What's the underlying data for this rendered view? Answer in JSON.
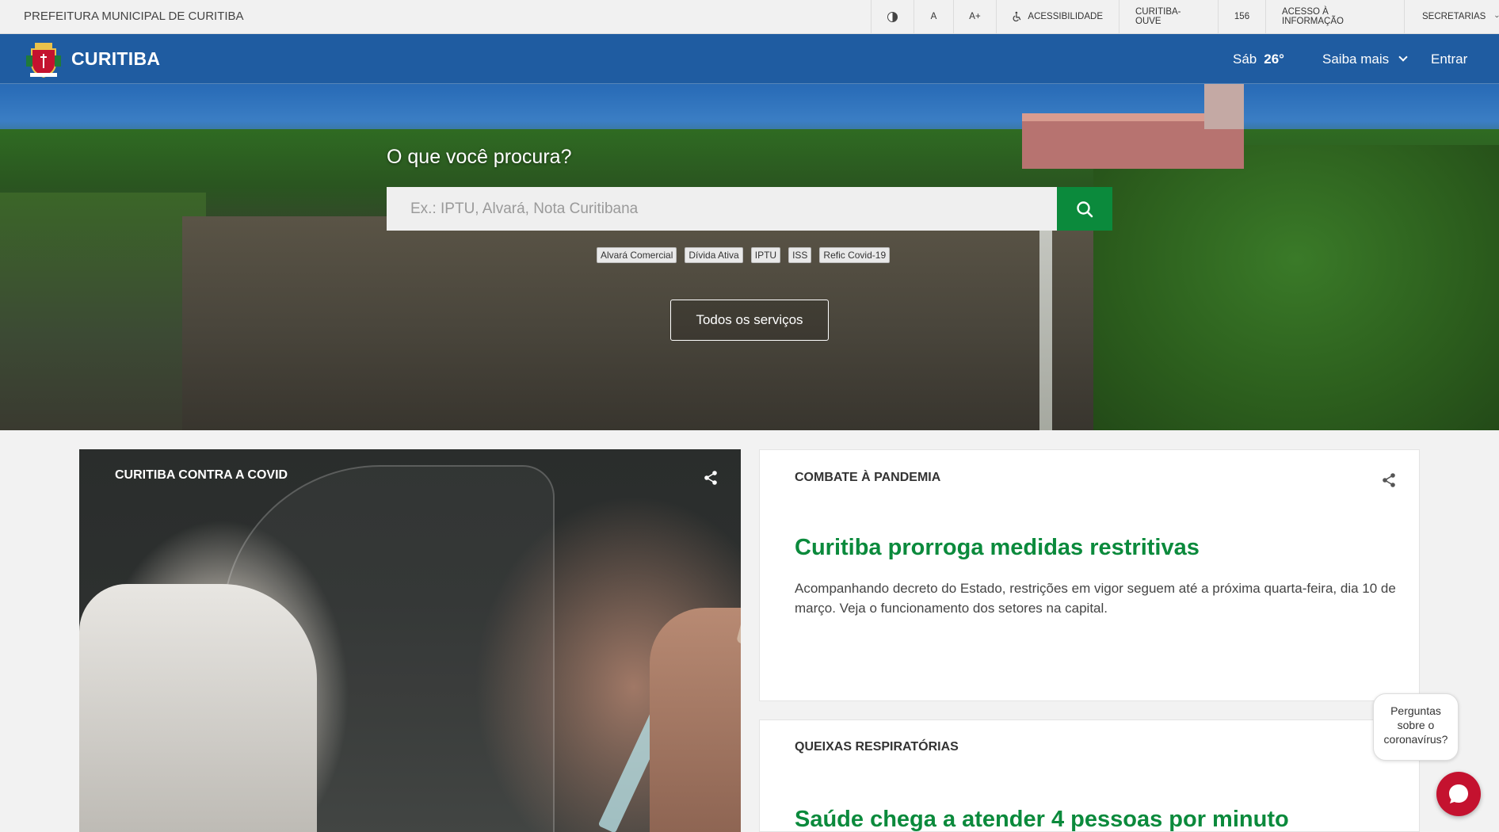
{
  "utility_bar": {
    "org_name": "PREFEITURA MUNICIPAL DE CURITIBA",
    "font_small": "A",
    "font_large": "A+",
    "accessibility": "ACESSIBILIDADE",
    "ouve": "CURITIBA-OUVE",
    "phone": "156",
    "info_access": "ACESSO À INFORMAÇÃO",
    "departments": "SECRETARIAS"
  },
  "header": {
    "brand": "CURITIBA",
    "weather_day": "Sáb",
    "weather_temp": "26°",
    "saiba_mais": "Saiba mais",
    "login": "Entrar"
  },
  "search": {
    "title": "O que você procura?",
    "placeholder": "Ex.: IPTU, Alvará, Nota Curitibana",
    "tags": [
      "Alvará Comercial",
      "Dívida Ativa",
      "IPTU",
      "ISS",
      "Refic Covid-19"
    ],
    "all_services": "Todos os serviços"
  },
  "featured": {
    "label": "CURITIBA CONTRA A COVID"
  },
  "news": [
    {
      "category": "COMBATE À PANDEMIA",
      "title": "Curitiba prorroga medidas restritivas",
      "description": "Acompanhando decreto do Estado, restrições em vigor seguem até a próxima quarta-feira, dia 10 de março. Veja o funcionamento dos setores na capital."
    },
    {
      "category": "QUEIXAS RESPIRATÓRIAS",
      "title": "Saúde chega a atender 4 pessoas por minuto"
    }
  ],
  "chat": {
    "bubble_text": "Perguntas sobre o coronavírus?"
  },
  "colors": {
    "header_blue": "#1f5ca1",
    "accent_green": "#0b8a3c",
    "chat_red": "#c4122f"
  },
  "icons": [
    "contrast-icon",
    "wheelchair-icon",
    "chevron-down-icon",
    "search-icon",
    "share-icon",
    "chat-icon",
    "coat-of-arms-logo"
  ]
}
